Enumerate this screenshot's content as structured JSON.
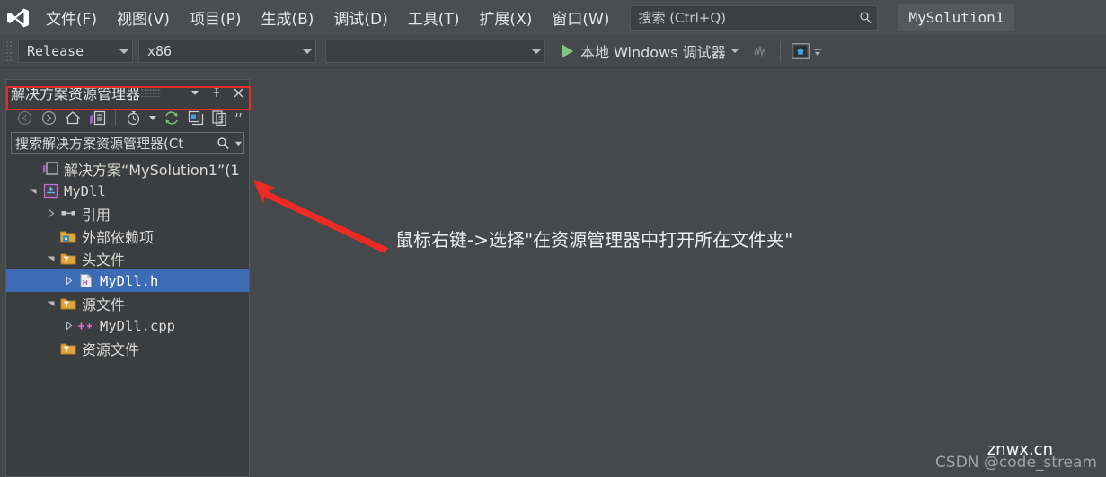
{
  "window": {
    "app_logo": "visual-studio-logo",
    "solution_tab_label": "MySolution1"
  },
  "menubar": {
    "items": [
      {
        "label": "文件(F)",
        "accel": "F"
      },
      {
        "label": "视图(V)",
        "accel": "V"
      },
      {
        "label": "项目(P)",
        "accel": "P"
      },
      {
        "label": "生成(B)",
        "accel": "B"
      },
      {
        "label": "调试(D)",
        "accel": "D"
      },
      {
        "label": "工具(T)",
        "accel": "T"
      },
      {
        "label": "扩展(X)",
        "accel": "X"
      },
      {
        "label": "窗口(W)",
        "accel": "W"
      }
    ],
    "search": {
      "placeholder": "搜索 (Ctrl+Q)",
      "icon": "search-icon"
    }
  },
  "toolbar": {
    "configuration": "Release",
    "platform": "x86",
    "target": "",
    "run_label": "本地 Windows 调试器",
    "play_icon": "play-icon",
    "hot_reload_icon": "hot-reload-icon",
    "home_icon": "live-share-icon"
  },
  "solution_explorer": {
    "title": "解决方案资源管理器",
    "title_buttons": [
      {
        "name": "preview-dots-icon"
      },
      {
        "name": "chevron-down-icon"
      },
      {
        "name": "pin-icon"
      },
      {
        "name": "close-icon"
      }
    ],
    "toolbar_icons": [
      {
        "name": "back-icon"
      },
      {
        "name": "forward-icon"
      },
      {
        "name": "home-icon"
      },
      {
        "name": "solution-explorer-icon"
      },
      {
        "name": "pending-changes-icon"
      },
      {
        "name": "refresh-icon"
      },
      {
        "name": "collapse-all-icon"
      },
      {
        "name": "show-all-files-icon"
      },
      {
        "name": "overflow-icon"
      }
    ],
    "search": {
      "placeholder": "搜索解决方案资源管理器(Ct",
      "icon": "search-icon",
      "dropdown_icon": "chevron-down-icon"
    },
    "tree": [
      {
        "label": "解决方案“MySolution1”(1",
        "icon": "solution-icon",
        "indent": 0,
        "twisty": "none",
        "selected": false,
        "cjk": true,
        "highlighted": true
      },
      {
        "label": "MyDll",
        "icon": "cpp-project-icon",
        "indent": 1,
        "twisty": "expanded",
        "selected": false,
        "cjk": false,
        "highlighted": false
      },
      {
        "label": "引用",
        "icon": "references-icon",
        "indent": 2,
        "twisty": "collapsed",
        "selected": false,
        "cjk": true,
        "highlighted": false
      },
      {
        "label": "外部依赖项",
        "icon": "external-deps-icon",
        "indent": 2,
        "twisty": "none",
        "selected": false,
        "cjk": true,
        "highlighted": false
      },
      {
        "label": "头文件",
        "icon": "filter-folder-icon",
        "indent": 2,
        "twisty": "expanded",
        "selected": false,
        "cjk": true,
        "highlighted": false
      },
      {
        "label": "MyDll.h",
        "icon": "header-file-icon",
        "indent": 3,
        "twisty": "collapsed",
        "selected": true,
        "cjk": false,
        "highlighted": false
      },
      {
        "label": "源文件",
        "icon": "filter-folder-icon",
        "indent": 2,
        "twisty": "expanded",
        "selected": false,
        "cjk": true,
        "highlighted": false
      },
      {
        "label": "MyDll.cpp",
        "icon": "cpp-file-icon",
        "indent": 3,
        "twisty": "collapsed",
        "selected": false,
        "cjk": false,
        "highlighted": false
      },
      {
        "label": "资源文件",
        "icon": "filter-folder-icon",
        "indent": 2,
        "twisty": "none",
        "selected": false,
        "cjk": true,
        "highlighted": false
      }
    ]
  },
  "annotation": {
    "text": "鼠标右键->选择\"在资源管理器中打开所在文件夹\"",
    "arrow_color": "#ed2b24",
    "highlight_color": "#ec2b25"
  },
  "watermarks": {
    "csdn": "CSDN @code_stream",
    "site": "znwx.cn"
  },
  "colors": {
    "menubar_bg": "#4a4e51",
    "app_bg": "#45494c",
    "panel_bg": "#3b3e40",
    "selection_blue": "#3d6cb5",
    "accent_red": "#ec2b25"
  }
}
